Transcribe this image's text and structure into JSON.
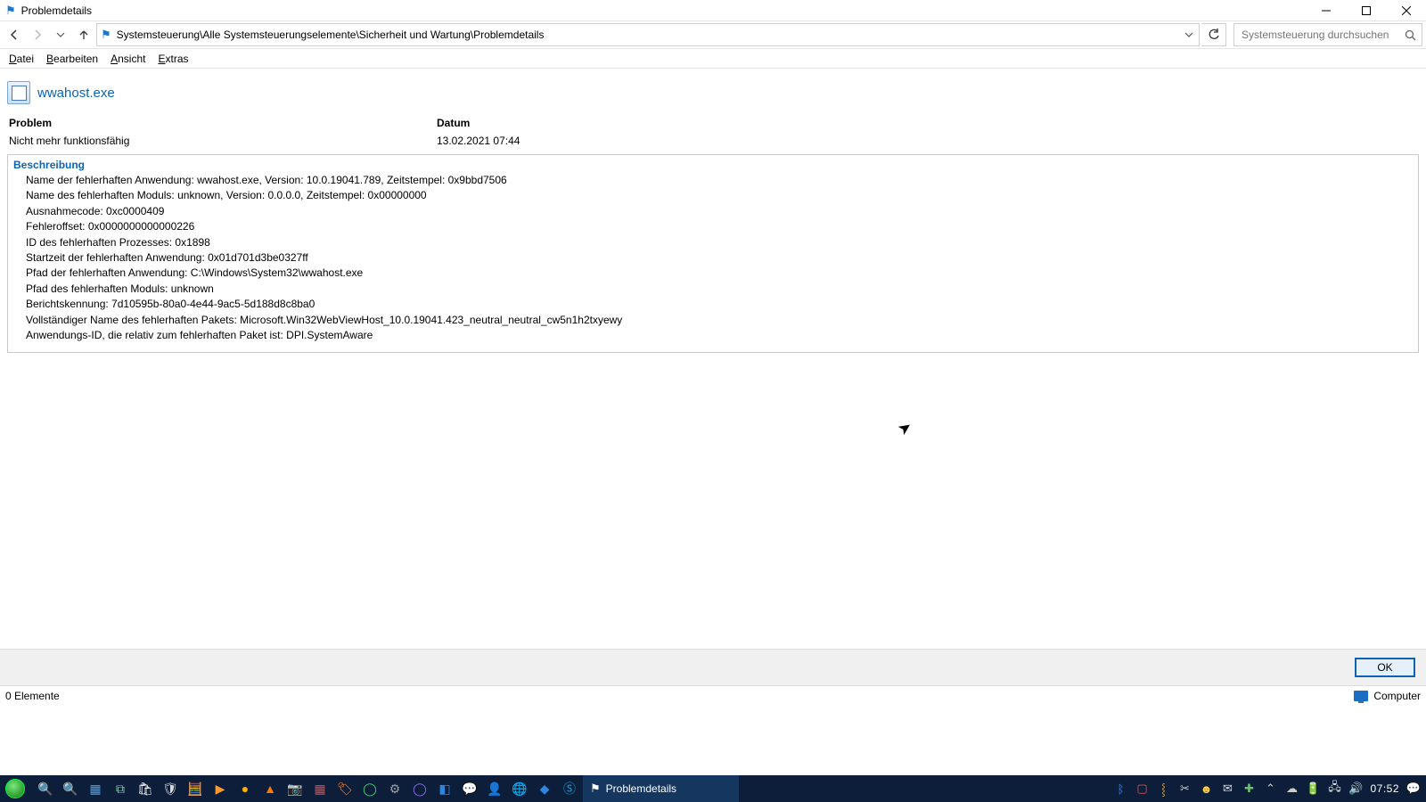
{
  "window": {
    "title": "Problemdetails"
  },
  "breadcrumb": "Systemsteuerung\\Alle Systemsteuerungselemente\\Sicherheit und Wartung\\Problemdetails",
  "search": {
    "placeholder": "Systemsteuerung durchsuchen"
  },
  "menu": {
    "file": "Datei",
    "edit": "Bearbeiten",
    "view": "Ansicht",
    "extras": "Extras"
  },
  "app": {
    "name": "wwahost.exe"
  },
  "columns": {
    "problem": "Problem",
    "date": "Datum"
  },
  "values": {
    "problem": "Nicht mehr funktionsfähig",
    "date": "13.02.2021 07:44"
  },
  "description": {
    "title": "Beschreibung",
    "lines": [
      "Name der fehlerhaften Anwendung: wwahost.exe, Version: 10.0.19041.789, Zeitstempel: 0x9bbd7506",
      "Name des fehlerhaften Moduls: unknown, Version: 0.0.0.0, Zeitstempel: 0x00000000",
      "Ausnahmecode: 0xc0000409",
      "Fehleroffset: 0x0000000000000226",
      "ID des fehlerhaften Prozesses: 0x1898",
      "Startzeit der fehlerhaften Anwendung: 0x01d701d3be0327ff",
      "Pfad der fehlerhaften Anwendung: C:\\Windows\\System32\\wwahost.exe",
      "Pfad des fehlerhaften Moduls: unknown",
      "Berichtskennung: 7d10595b-80a0-4e44-9ac5-5d188d8c8ba0",
      "Vollständiger Name des fehlerhaften Pakets: Microsoft.Win32WebViewHost_10.0.19041.423_neutral_neutral_cw5n1h2txyewy",
      "Anwendungs-ID, die relativ zum fehlerhaften Paket ist: DPI.SystemAware"
    ]
  },
  "buttons": {
    "ok": "OK"
  },
  "status": {
    "left": "0 Elemente",
    "right": "Computer"
  },
  "taskbar": {
    "active_task": "Problemdetails",
    "clock": "07:52"
  }
}
